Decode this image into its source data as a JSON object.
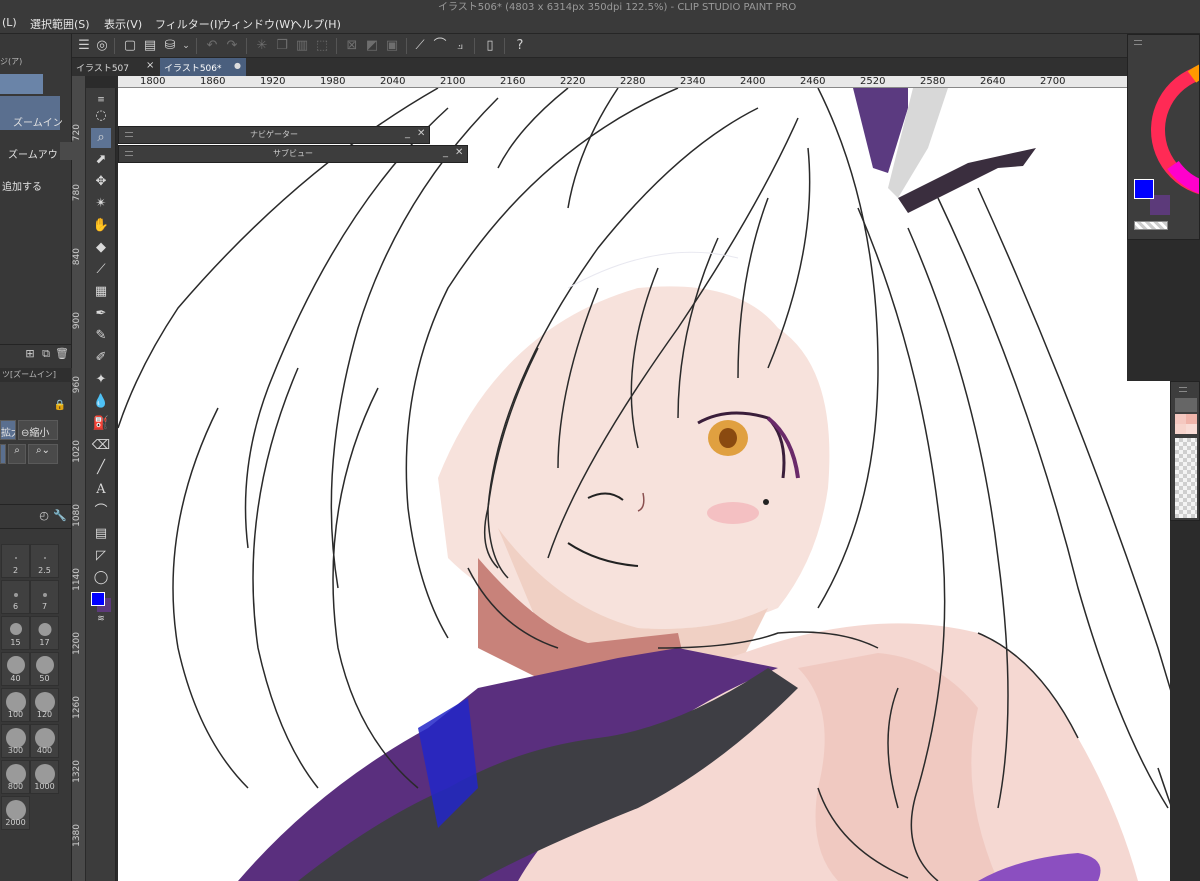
{
  "window": {
    "title": "イラスト506* (4803 x 6314px 350dpi 122.5%) - CLIP STUDIO PAINT PRO"
  },
  "menu": {
    "items": [
      "(L)",
      "選択範囲(S)",
      "表示(V)",
      "フィルター(I)",
      "ウィンドウ(W)",
      "ヘルプ(H)"
    ]
  },
  "tabs": [
    {
      "label": "イラスト507",
      "marker": "×"
    },
    {
      "label": "イラスト506*",
      "marker": "●"
    }
  ],
  "left_panel": {
    "tab_label": "ジ(ア)",
    "zoom_in_label": "ズームイン",
    "zoom_out_label": "ズームアウト",
    "add_label": "追加する",
    "tool_property_title": "ツ[ズームイン]",
    "enlarge_label": "拡大",
    "shrink_label": "縮小",
    "brush_sizes": [
      "2",
      "2.5",
      "6",
      "7",
      "15",
      "17",
      "40",
      "50",
      "100",
      "120",
      "300",
      "400",
      "800",
      "1000",
      "2000"
    ]
  },
  "ruler": {
    "horizontal": [
      "1800",
      "1860",
      "1920",
      "1980",
      "2040",
      "2100",
      "2160",
      "2220",
      "2280",
      "2340",
      "2400",
      "2460",
      "2520",
      "2580",
      "2640",
      "2700"
    ],
    "vertical": [
      "720",
      "780",
      "840",
      "900",
      "960",
      "1020",
      "1080",
      "1140",
      "1200",
      "1260",
      "1320",
      "1380"
    ]
  },
  "floating_panels": {
    "navigator_title": "ナビゲーター",
    "subview_title": "サブビュー"
  },
  "colors": {
    "main": "#0000ff",
    "sub": "#5c3a7a",
    "accent": "#5d7394"
  }
}
